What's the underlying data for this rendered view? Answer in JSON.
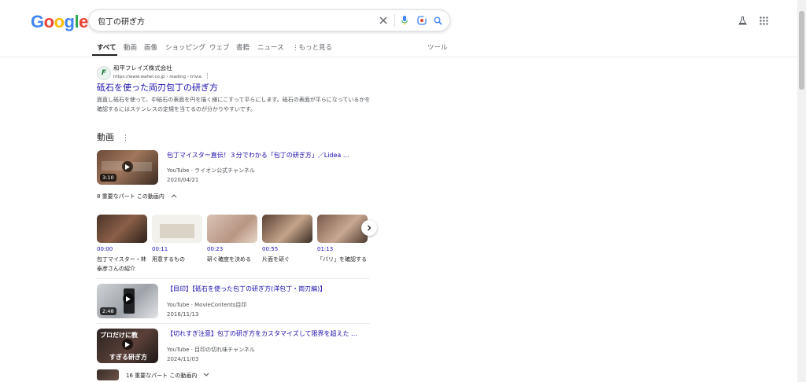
{
  "logo": {
    "letters": [
      "G",
      "o",
      "o",
      "g",
      "l",
      "e"
    ],
    "colors": [
      "#4285F4",
      "#EA4335",
      "#FBBC05",
      "#4285F4",
      "#34A853",
      "#EA4335"
    ]
  },
  "search": {
    "query": "包丁の研ぎ方"
  },
  "tabs": [
    {
      "label": "すべて",
      "active": true
    },
    {
      "label": "動画"
    },
    {
      "label": "画像"
    },
    {
      "label": "ショッピング"
    },
    {
      "label": "ウェブ"
    },
    {
      "label": "書籍"
    },
    {
      "label": "ニュース"
    },
    {
      "label": "もっと見る"
    }
  ],
  "tools_label": "ツール",
  "icons": {
    "clear": "close-icon",
    "mic": "mic-icon",
    "lens": "lens-icon",
    "search": "search-icon",
    "labs": "flask-icon",
    "apps": "apps-grid-icon"
  },
  "result": {
    "favicon_letter": "F",
    "site_name": "和平フレイズ株式会社",
    "url": "https://www.wahei.co.jp › reading › trivia",
    "title": "砥石を使った両刃包丁の研ぎ方",
    "snippet": "面直し砥石を使って、中砥石の表面を円を描く様にこすって平らにします。砥石の表面が平らになっているかを確認するにはステンレスの定規を当てるのが分かりやすいです。"
  },
  "videos": {
    "heading": "動画",
    "items": [
      {
        "title": "包丁マイスター直伝！３分でわかる「包丁の研ぎ方」／Lidea ...",
        "source": "YouTube · ライオン公式チャンネル",
        "date": "2020/04/21",
        "duration": "3:10",
        "parts_label": "8 重要なパート この動画内",
        "clips": [
          {
            "time": "00:00",
            "label": "包丁マイスター・林泰彦さんの紹介"
          },
          {
            "time": "00:11",
            "label": "用意するもの"
          },
          {
            "time": "00:23",
            "label": "研ぐ確度を決める"
          },
          {
            "time": "00:55",
            "label": "片面を研ぐ"
          },
          {
            "time": "01:13",
            "label": "「バリ」を確認する"
          }
        ]
      },
      {
        "title": "【目印】【砥石を使った包丁の研ぎ方(洋包丁・両刃編)】",
        "source": "YouTube · MovieContents目印",
        "date": "2016/11/13",
        "duration": "2:48"
      },
      {
        "title": "【切れすぎ注意】包丁の研ぎ方をカスタマイズして限界を超えた ...",
        "source": "YouTube · 目印の切れ味チャンネル",
        "date": "2024/11/03",
        "overlay_text_1": "プロだけに教",
        "overlay_text_2": "すぎる研ぎ方",
        "parts_label": "16 重要なパート この動画内"
      }
    ]
  }
}
